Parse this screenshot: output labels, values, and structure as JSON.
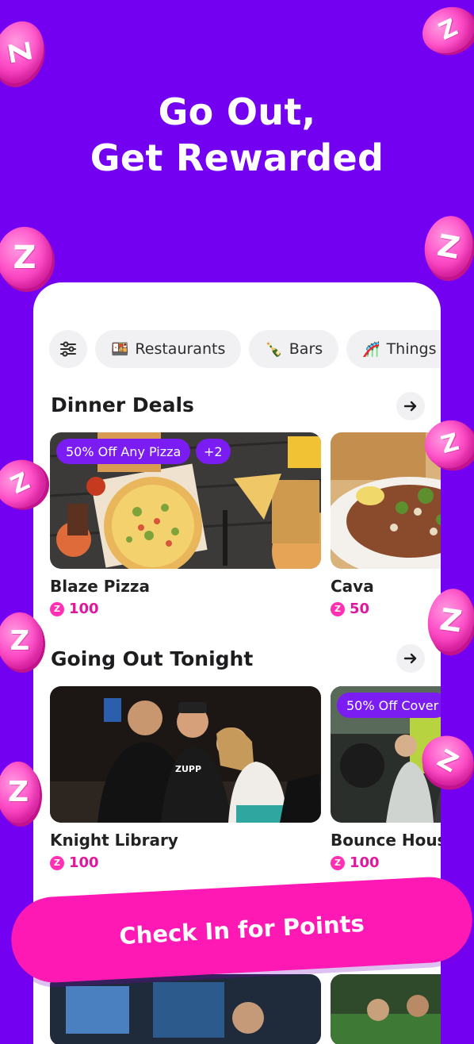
{
  "hero": {
    "line1": "Go Out,",
    "line2": "Get Rewarded"
  },
  "filters": [
    {
      "emoji": "🍱",
      "label": "Restaurants"
    },
    {
      "emoji": "🍾",
      "label": "Bars"
    },
    {
      "emoji": "🎢",
      "label": "Things T"
    }
  ],
  "sections": [
    {
      "title": "Dinner Deals",
      "cards": [
        {
          "name": "Blaze Pizza",
          "points": "100",
          "badge": "50% Off Any Pizza",
          "extra": "+2"
        },
        {
          "name": "Cava",
          "points": "50"
        }
      ]
    },
    {
      "title": "Going Out Tonight",
      "cards": [
        {
          "name": "Knight Library",
          "points": "100",
          "shirt_text": "ZUPP"
        },
        {
          "name": "Bounce House",
          "points": "100",
          "badge": "50% Off Cover"
        }
      ]
    }
  ],
  "cta": {
    "label": "Check In for Points"
  },
  "coin_glyph": "Z",
  "colors": {
    "background": "#7400f2",
    "accent_pink": "#ff19b4",
    "badge_purple": "#7a1cf2"
  }
}
